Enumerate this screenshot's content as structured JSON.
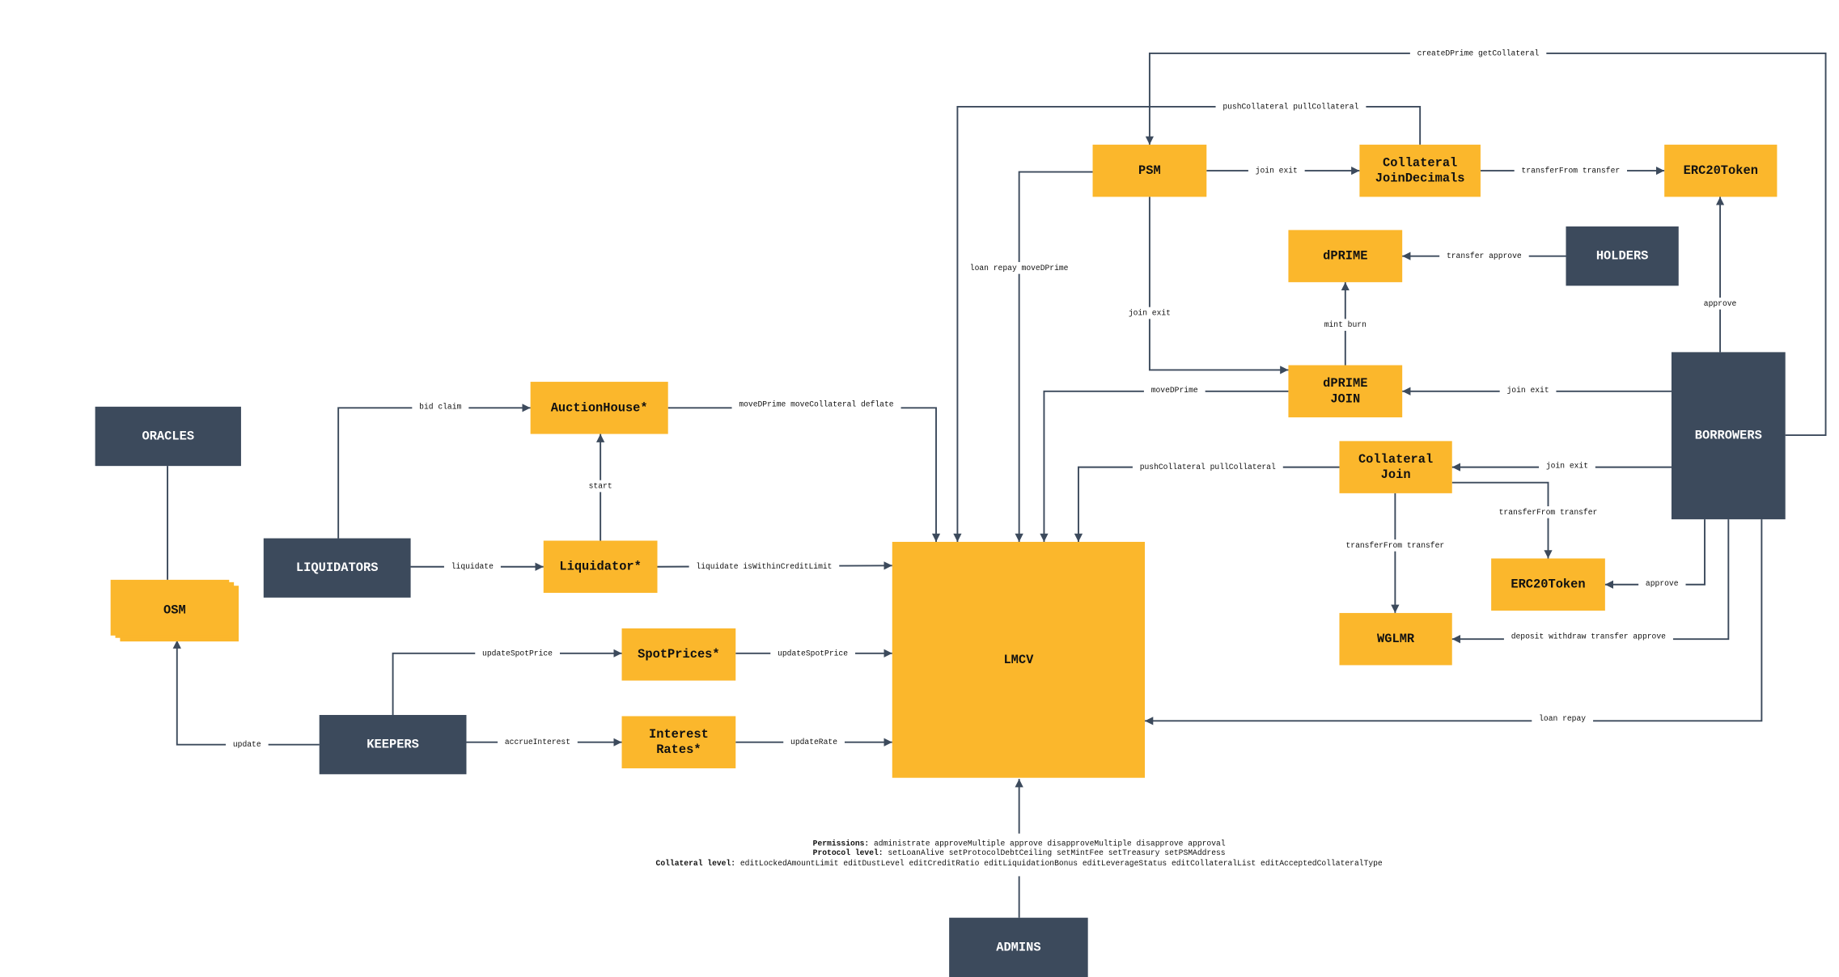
{
  "colors": {
    "actor": "#3c4a5c",
    "contract": "#fbb72c",
    "edge": "#3c4a5c"
  },
  "nodes": [
    {
      "id": "oracles",
      "kind": "actor",
      "lines": [
        "ORACLES"
      ]
    },
    {
      "id": "osm",
      "kind": "contract",
      "lines": [
        "OSM"
      ]
    },
    {
      "id": "liquidators",
      "kind": "actor",
      "lines": [
        "LIQUIDATORS"
      ]
    },
    {
      "id": "keepers",
      "kind": "actor",
      "lines": [
        "KEEPERS"
      ]
    },
    {
      "id": "auctionhouse",
      "kind": "contract",
      "lines": [
        "AuctionHouse*"
      ]
    },
    {
      "id": "liquidator",
      "kind": "contract",
      "lines": [
        "Liquidator*"
      ]
    },
    {
      "id": "spotprices",
      "kind": "contract",
      "lines": [
        "SpotPrices*"
      ]
    },
    {
      "id": "interestrates",
      "kind": "contract",
      "lines": [
        "Interest",
        "Rates*"
      ]
    },
    {
      "id": "lmcv",
      "kind": "contract",
      "lines": [
        "LMCV"
      ]
    },
    {
      "id": "admins",
      "kind": "actor",
      "lines": [
        "ADMINS"
      ]
    },
    {
      "id": "psm",
      "kind": "contract",
      "lines": [
        "PSM"
      ]
    },
    {
      "id": "colljoindecimals",
      "kind": "contract",
      "lines": [
        "Collateral",
        "JoinDecimals"
      ]
    },
    {
      "id": "erc20top",
      "kind": "contract",
      "lines": [
        "ERC20Token"
      ]
    },
    {
      "id": "dprime",
      "kind": "contract",
      "lines": [
        "dPRIME"
      ]
    },
    {
      "id": "holders",
      "kind": "actor",
      "lines": [
        "HOLDERS"
      ]
    },
    {
      "id": "dprimejoin",
      "kind": "contract",
      "lines": [
        "dPRIME",
        "JOIN"
      ]
    },
    {
      "id": "colljoin",
      "kind": "contract",
      "lines": [
        "Collateral",
        "Join"
      ]
    },
    {
      "id": "borrowers",
      "kind": "actor",
      "lines": [
        "BORROWERS"
      ]
    },
    {
      "id": "erc20low",
      "kind": "contract",
      "lines": [
        "ERC20Token"
      ]
    },
    {
      "id": "wglmr",
      "kind": "contract",
      "lines": [
        "WGLMR"
      ]
    }
  ],
  "edges": [
    {
      "id": "e1",
      "from": "BORROWERS",
      "to": "PSM",
      "label": "createDPrime getCollateral"
    },
    {
      "id": "e2",
      "from": "Collateral JoinDecimals",
      "to": "LMCV",
      "label": "pushCollateral pullCollateral"
    },
    {
      "id": "e3",
      "from": "PSM",
      "to": "Collateral JoinDecimals",
      "label": "join exit"
    },
    {
      "id": "e4",
      "from": "Collateral JoinDecimals",
      "to": "ERC20Token",
      "label": "transferFrom transfer"
    },
    {
      "id": "e5",
      "from": "PSM",
      "to": "LMCV",
      "label": "loan repay moveDPrime"
    },
    {
      "id": "e6",
      "from": "PSM",
      "to": "dPRIME JOIN",
      "label": "join exit"
    },
    {
      "id": "e7",
      "from": "HOLDERS",
      "to": "dPRIME",
      "label": "transfer approve"
    },
    {
      "id": "e8",
      "from": "dPRIME JOIN",
      "to": "dPRIME",
      "label": "mint burn"
    },
    {
      "id": "e9",
      "from": "BORROWERS",
      "to": "ERC20Token",
      "label": "approve"
    },
    {
      "id": "e10",
      "from": "BORROWERS",
      "to": "dPRIME JOIN",
      "label": "join exit"
    },
    {
      "id": "e11",
      "from": "dPRIME JOIN",
      "to": "LMCV",
      "label": "moveDPrime"
    },
    {
      "id": "e12",
      "from": "BORROWERS",
      "to": "Collateral Join",
      "label": "join exit"
    },
    {
      "id": "e13",
      "from": "Collateral Join",
      "to": "LMCV",
      "label": "pushCollateral pullCollateral"
    },
    {
      "id": "e14",
      "from": "Collateral Join",
      "to": "ERC20Token",
      "label": "transferFrom transfer"
    },
    {
      "id": "e15",
      "from": "Collateral Join",
      "to": "WGLMR",
      "label": "transferFrom transfer"
    },
    {
      "id": "e16",
      "from": "BORROWERS",
      "to": "ERC20Token",
      "label": "approve"
    },
    {
      "id": "e17",
      "from": "BORROWERS",
      "to": "WGLMR",
      "label": "deposit withdraw transfer approve"
    },
    {
      "id": "e18",
      "from": "BORROWERS",
      "to": "LMCV",
      "label": "loan repay"
    },
    {
      "id": "e19",
      "from": "ORACLES",
      "to": "OSM",
      "label": ""
    },
    {
      "id": "e20",
      "from": "KEEPERS",
      "to": "OSM",
      "label": "update"
    },
    {
      "id": "e21",
      "from": "LIQUIDATORS",
      "to": "AuctionHouse*",
      "label": "bid claim"
    },
    {
      "id": "e22",
      "from": "AuctionHouse*",
      "to": "LMCV",
      "label": "moveDPrime moveCollateral deflate"
    },
    {
      "id": "e23",
      "from": "Liquidator*",
      "to": "AuctionHouse*",
      "label": "start"
    },
    {
      "id": "e24",
      "from": "LIQUIDATORS",
      "to": "Liquidator*",
      "label": "liquidate"
    },
    {
      "id": "e25",
      "from": "Liquidator*",
      "to": "LMCV",
      "label": "liquidate isWithinCreditLimit"
    },
    {
      "id": "e26",
      "from": "KEEPERS",
      "to": "SpotPrices*",
      "label": "updateSpotPrice"
    },
    {
      "id": "e27",
      "from": "SpotPrices*",
      "to": "LMCV",
      "label": "updateSpotPrice"
    },
    {
      "id": "e28",
      "from": "KEEPERS",
      "to": "Interest Rates*",
      "label": "accrueInterest"
    },
    {
      "id": "e29",
      "from": "Interest Rates*",
      "to": "LMCV",
      "label": "updateRate"
    },
    {
      "id": "e30",
      "from": "ADMINS",
      "to": "LMCV",
      "label": ""
    }
  ],
  "permissions": [
    {
      "heading": "Permissions:",
      "items": "administrate approveMultiple approve disapproveMultiple disapprove approval"
    },
    {
      "heading": "Protocol level:",
      "items": "setLoanAlive setProtocolDebtCeiling setMintFee setTreasury setPSMAddress"
    },
    {
      "heading": "Collateral level:",
      "items": "editLockedAmountLimit editDustLevel editCreditRatio editLiquidationBonus editLeverageStatus editCollateralList editAcceptedCollateralType"
    }
  ]
}
